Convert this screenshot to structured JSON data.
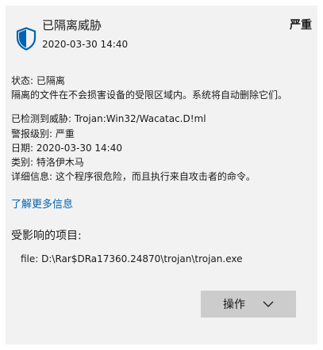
{
  "header": {
    "title": "已隔离威胁",
    "date": "2020-03-30 14:40",
    "severity": "严重",
    "icon": "shield-icon"
  },
  "status": {
    "label_line": "状态: 已隔离",
    "description": "隔离的文件在不会损害设备的受限区域内。系统将自动删除它们。"
  },
  "details": {
    "detected": "已检测到威胁: Trojan:Win32/Wacatac.D!ml",
    "alert_level": "警报级别: 严重",
    "date": "日期: 2020-03-30 14:40",
    "category": "类别: 特洛伊木马",
    "info": "详细信息: 这个程序很危险，而且执行来自攻击者的命令。"
  },
  "learn_more": "了解更多信息",
  "affected": {
    "heading": "受影响的项目:",
    "file": "file: D:\\Rar$DRa17360.24870\\trojan\\trojan.exe"
  },
  "actions": {
    "button_label": "操作"
  },
  "colors": {
    "accent": "#0063b1",
    "panel_bg": "#f2f2f2",
    "button_bg": "#cccccc"
  }
}
